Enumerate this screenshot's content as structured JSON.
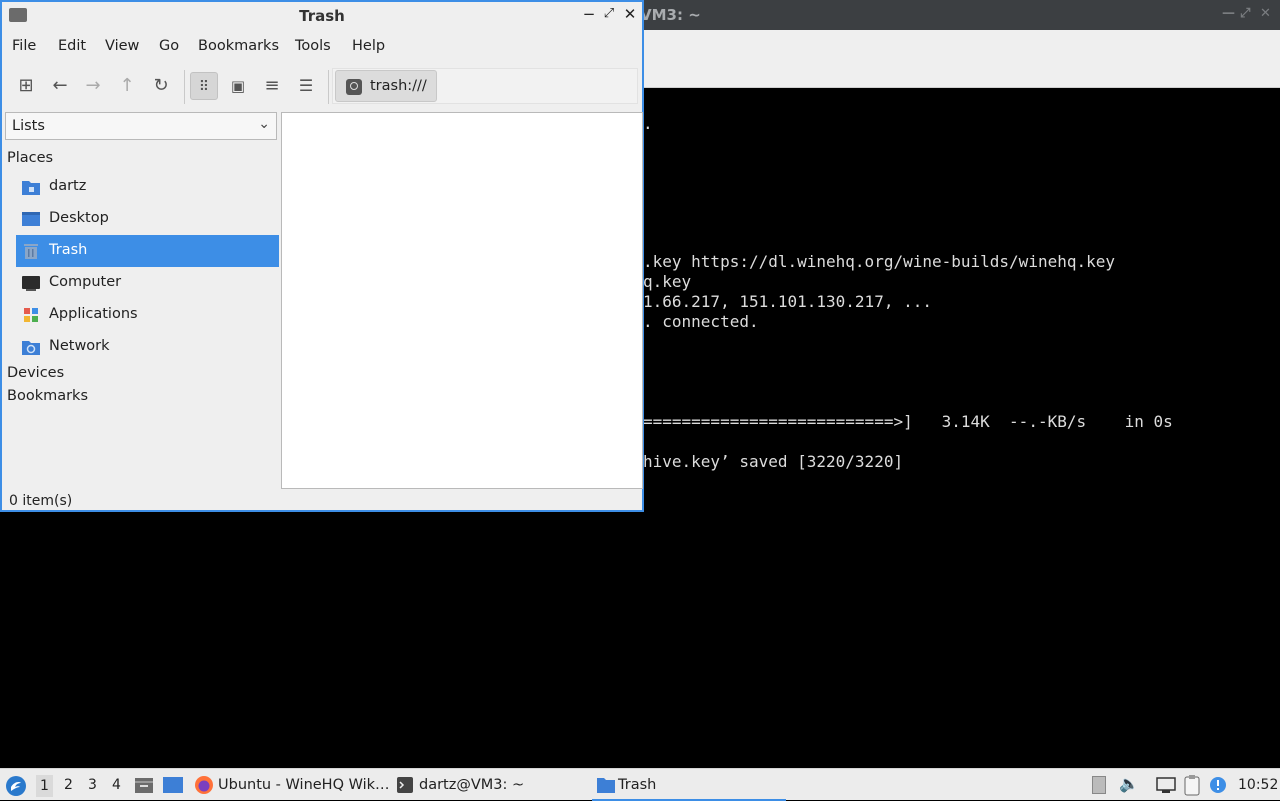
{
  "terminal": {
    "title": "VM3: ~",
    "lines": [
      {
        "text": "."
      },
      {
        "text": ".key https://dl.winehq.org/wine-builds/winehq.key"
      },
      {
        "text": "q.key"
      },
      {
        "text": "1.66.217, 151.101.130.217, ..."
      },
      {
        "text": ". connected."
      },
      {
        "text": "==========================>]   3.14K  --.-KB/s    in 0s"
      },
      {
        "text": "hive.key’ saved [3220/3220]"
      }
    ]
  },
  "file_manager": {
    "title": "Trash",
    "menu": [
      "File",
      "Edit",
      "View",
      "Go",
      "Bookmarks",
      "Tools",
      "Help"
    ],
    "location": "trash:///",
    "side_pane_mode": "Lists",
    "sections": {
      "places": "Places",
      "devices": "Devices",
      "bookmarks": "Bookmarks"
    },
    "places": [
      {
        "label": "dartz",
        "icon": "home-folder-icon"
      },
      {
        "label": "Desktop",
        "icon": "desktop-icon"
      },
      {
        "label": "Trash",
        "icon": "trash-icon",
        "selected": true
      },
      {
        "label": "Computer",
        "icon": "computer-icon"
      },
      {
        "label": "Applications",
        "icon": "applications-icon"
      },
      {
        "label": "Network",
        "icon": "network-icon"
      }
    ],
    "status": "0 item(s)"
  },
  "taskbar": {
    "workspaces": [
      "1",
      "2",
      "3",
      "4"
    ],
    "current_workspace": "1",
    "tasks": [
      {
        "label": "Ubuntu - WineHQ Wik…",
        "icon": "firefox-icon"
      },
      {
        "label": "dartz@VM3: ~",
        "icon": "terminal-icon"
      },
      {
        "label": "Trash",
        "icon": "folder-icon",
        "active": true
      }
    ],
    "clock": "10:52"
  },
  "colors": {
    "accent": "#3d8ee6",
    "terminal_bg": "#000000",
    "panel_bg": "#efefef"
  }
}
